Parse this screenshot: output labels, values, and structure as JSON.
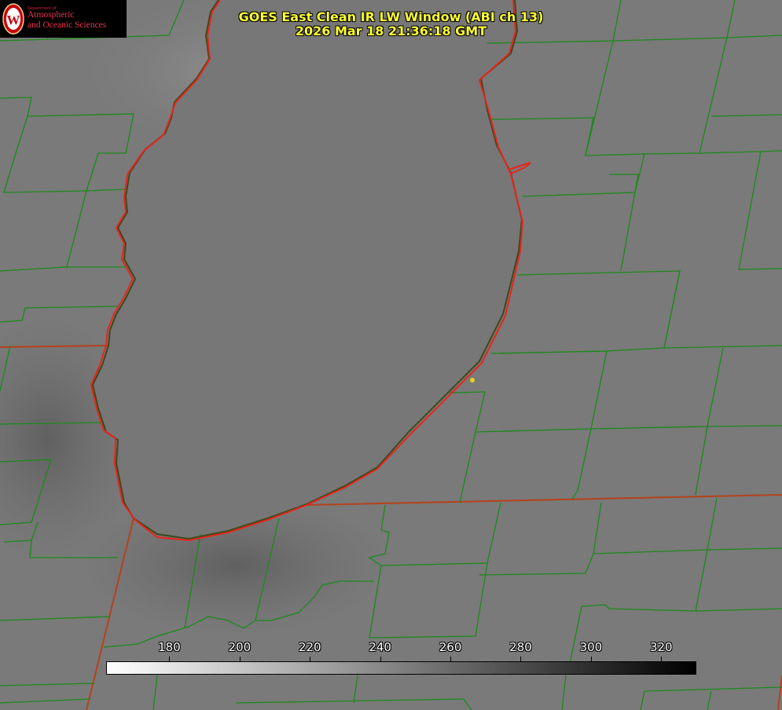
{
  "header": {
    "title_line1": "GOES East Clean IR LW Window (ABI ch 13)",
    "title_line2": "2026 Mar 18 21:36:18 GMT"
  },
  "logo": {
    "letter": "W",
    "dept_line": "Department of",
    "line1": "Atmospheric",
    "line2": "and Oceanic Sciences"
  },
  "colorbar": {
    "min": 162,
    "max": 330,
    "ticks": [
      "180",
      "200",
      "220",
      "240",
      "260",
      "280",
      "300",
      "320"
    ],
    "gradient_from": "#ffffff",
    "gradient_to": "#000000"
  },
  "colors": {
    "lake_outline": "#e8241c",
    "county_lines": "#1a8a1a",
    "state_lines": "#b5421a",
    "title_text": "#ffff33",
    "marker": "#e6d21a"
  }
}
